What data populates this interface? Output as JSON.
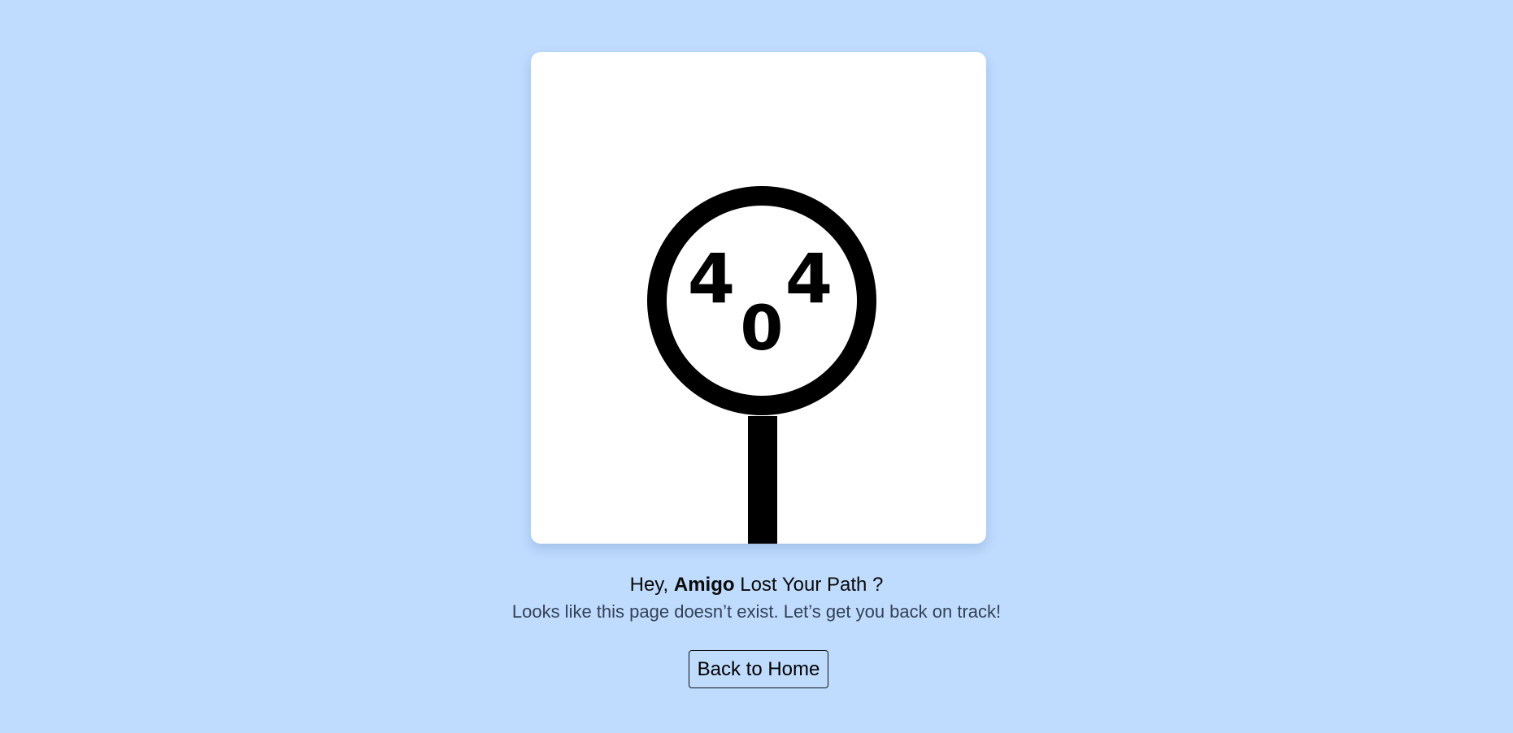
{
  "illustration": {
    "digit_left": "4",
    "digit_middle": "0",
    "digit_right": "4",
    "icon": "magnifying-glass-icon"
  },
  "message": {
    "greeting": "Hey,",
    "name": "Amigo",
    "question": "Lost Your Path ?",
    "description": "Looks like this page doesn’t exist. Let’s get you back on track!"
  },
  "actions": {
    "home_label": "Back to Home"
  },
  "colors": {
    "background": "#bfdbfe",
    "card": "#ffffff",
    "ink": "#000000",
    "subtext": "#334155"
  }
}
